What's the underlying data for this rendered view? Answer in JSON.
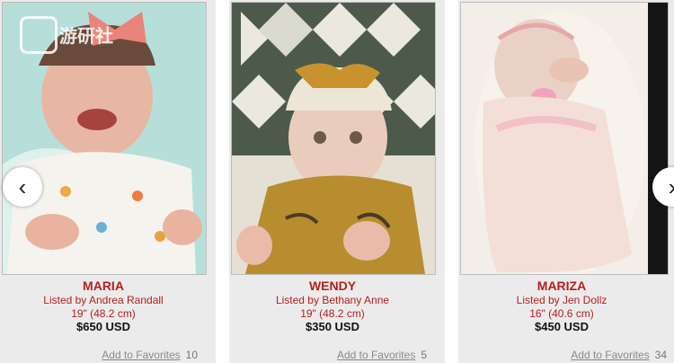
{
  "listings": [
    {
      "name": "MARIA",
      "listed_by": "Listed by Andrea Randall",
      "size": "19\" (48.2 cm)",
      "price": "$650 USD",
      "favorites_label": "Add to Favorites",
      "favorites_count": "10"
    },
    {
      "name": "WENDY",
      "listed_by": "Listed by Bethany Anne",
      "size": "19\" (48.2 cm)",
      "price": "$350 USD",
      "favorites_label": "Add to Favorites",
      "favorites_count": "5"
    },
    {
      "name": "MARIZA",
      "listed_by": "Listed by Jen Dollz",
      "size": "16\" (40.6 cm)",
      "price": "$450 USD",
      "favorites_label": "Add to Favorites",
      "favorites_count": "34"
    }
  ],
  "carousel": {
    "prev_icon": "‹",
    "next_icon": "›"
  },
  "watermark": {
    "text": "游研社"
  },
  "colors": {
    "name_red": "#b51e1e",
    "card_bg": "#ebebeb"
  }
}
